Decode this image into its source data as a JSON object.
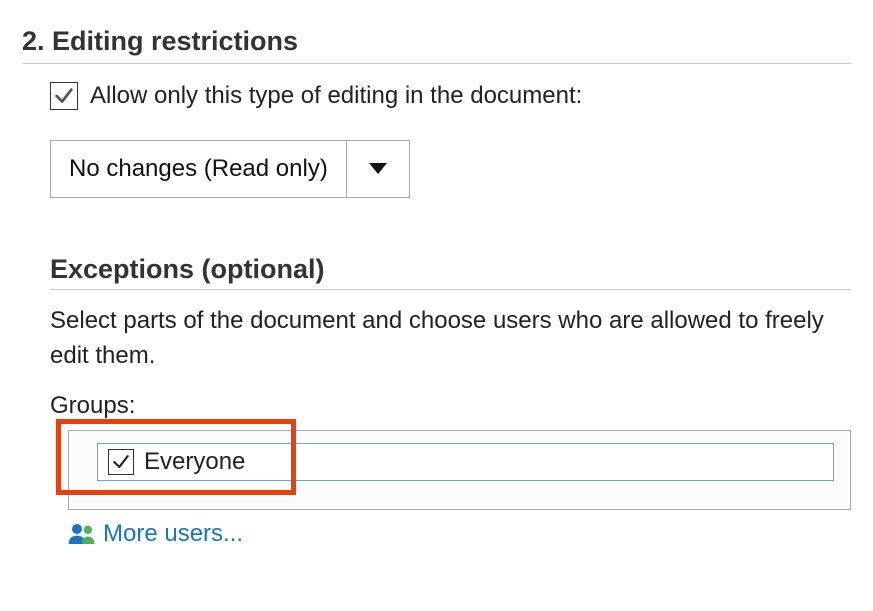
{
  "section": {
    "title": "2. Editing restrictions",
    "allow_label": "Allow only this type of editing in the document:",
    "editing_type": "No changes (Read only)"
  },
  "exceptions": {
    "title": "Exceptions (optional)",
    "explain": "Select parts of the document and choose users who are allowed to freely edit them.",
    "groups_label": "Groups:",
    "group_everyone": "Everyone",
    "more_users": "More users..."
  }
}
